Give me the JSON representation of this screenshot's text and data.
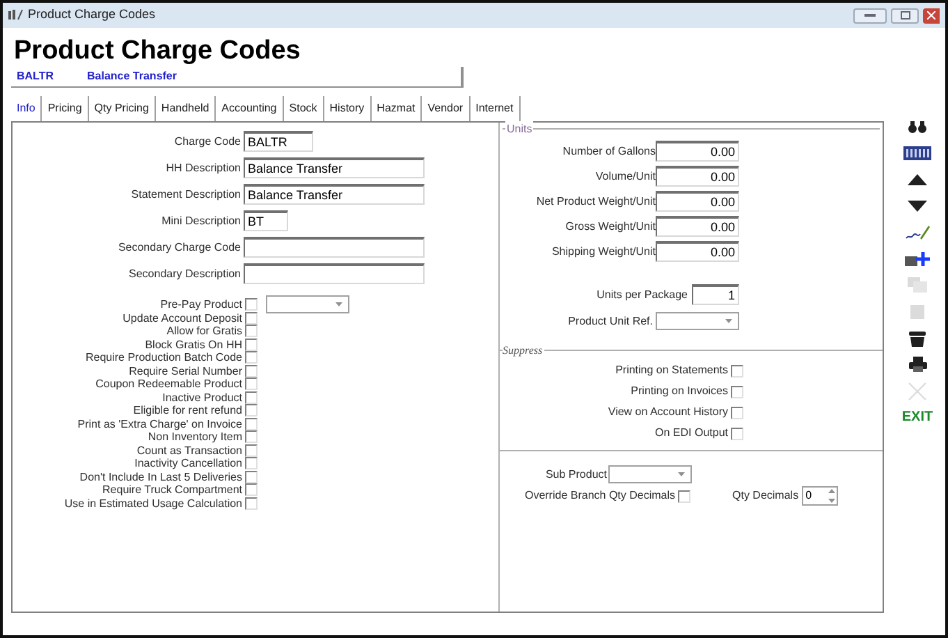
{
  "window": {
    "title": "Product Charge Codes"
  },
  "header": {
    "title": "Product Charge Codes",
    "code": "BALTR",
    "description": "Balance Transfer"
  },
  "tabs": [
    {
      "label": "Info",
      "selected": true
    },
    {
      "label": "Pricing",
      "selected": false
    },
    {
      "label": "Qty Pricing",
      "selected": false
    },
    {
      "label": "Handheld",
      "selected": false
    },
    {
      "label": "Accounting",
      "selected": false
    },
    {
      "label": "Stock",
      "selected": false
    },
    {
      "label": "History",
      "selected": false
    },
    {
      "label": "Hazmat",
      "selected": false
    },
    {
      "label": "Vendor",
      "selected": false
    },
    {
      "label": "Internet",
      "selected": false
    }
  ],
  "fields": [
    {
      "label": "Charge Code",
      "value": "BALTR",
      "kind": "short"
    },
    {
      "label": "HH Description",
      "value": "Balance Transfer",
      "kind": "long"
    },
    {
      "label": "Statement Description",
      "value": "Balance Transfer",
      "kind": "long"
    },
    {
      "label": "Mini Description",
      "value": "BT",
      "kind": "tiny"
    },
    {
      "label": "Secondary Charge Code",
      "kind": "long"
    },
    {
      "label": "Secondary Description",
      "kind": "long"
    }
  ],
  "options": [
    {
      "label": "Pre-Pay Product",
      "checked": false,
      "dropdown": true
    },
    {
      "label": "Update Account Deposit",
      "checked": false
    },
    {
      "label": "Allow for Gratis",
      "checked": false
    },
    {
      "label": "Block Gratis On HH",
      "checked": false
    },
    {
      "label": "Require Production Batch Code",
      "checked": false
    },
    {
      "label": "Require Serial Number",
      "checked": false
    },
    {
      "label": "Coupon Redeemable Product",
      "checked": false
    },
    {
      "label": "Inactive Product",
      "checked": false
    },
    {
      "label": "Eligible for rent refund",
      "checked": false
    },
    {
      "label": "Print as 'Extra Charge' on Invoice",
      "checked": false
    },
    {
      "label": "Non Inventory Item",
      "checked": false
    },
    {
      "label": "Count as Transaction",
      "checked": false
    },
    {
      "label": "Inactivity Cancellation",
      "checked": false
    },
    {
      "label": "Don't Include In Last 5 Deliveries",
      "checked": false
    },
    {
      "label": "Require Truck Compartment",
      "checked": false
    },
    {
      "label": "Use in Estimated Usage Calculation",
      "checked": false
    }
  ],
  "units": {
    "title": "Units",
    "fields": [
      {
        "label": "Number of Gallons",
        "value": "0.00"
      },
      {
        "label": "Volume/Unit",
        "value": "0.00"
      },
      {
        "label": "Net Product Weight/Unit",
        "value": "0.00"
      },
      {
        "label": "Gross Weight/Unit",
        "value": "0.00"
      },
      {
        "label": "Shipping Weight/Unit",
        "value": "0.00"
      }
    ],
    "units_per_package": {
      "label": "Units per Package",
      "value": "1"
    },
    "product_unit_ref": {
      "label": "Product Unit Ref."
    }
  },
  "suppress": {
    "title": "Suppress",
    "options": [
      {
        "label": "Printing on Statements",
        "checked": false
      },
      {
        "label": "Printing on Invoices",
        "checked": false
      },
      {
        "label": "View on Account History",
        "checked": false
      },
      {
        "label": "On EDI Output",
        "checked": false
      }
    ]
  },
  "sub_product": {
    "label": "Sub Product"
  },
  "override": {
    "label": "Override Branch Qty Decimals",
    "checked": false
  },
  "qty_decimals": {
    "label": "Qty Decimals",
    "value": "0"
  },
  "toolbar": [
    {
      "kind": "search",
      "disabled": false
    },
    {
      "kind": "barcode",
      "disabled": false
    },
    {
      "kind": "up",
      "disabled": false
    },
    {
      "kind": "down",
      "disabled": false
    },
    {
      "kind": "sign",
      "disabled": false
    },
    {
      "kind": "add",
      "disabled": false
    },
    {
      "kind": "copy",
      "disabled": true
    },
    {
      "kind": "square",
      "disabled": true
    },
    {
      "kind": "trash",
      "disabled": false
    },
    {
      "kind": "print",
      "disabled": false
    },
    {
      "kind": "close",
      "disabled": true
    },
    {
      "kind": "exit",
      "label": "EXIT",
      "disabled": false
    }
  ]
}
